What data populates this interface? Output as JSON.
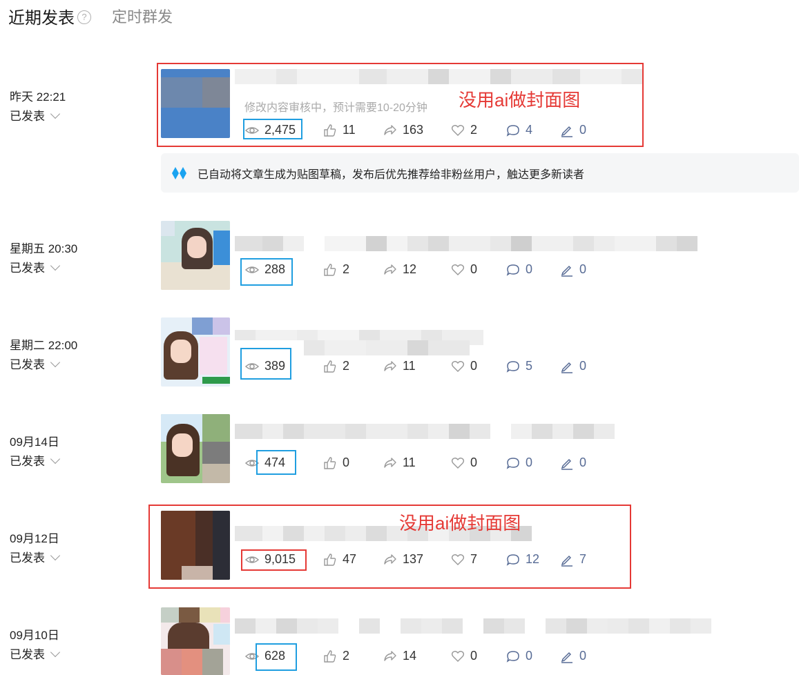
{
  "tabs": {
    "active": "近期发表",
    "other": "定时群发",
    "help_icon": "?"
  },
  "posts": [
    {
      "date": "昨天 22:21",
      "status": "已发表",
      "review_note": "修改内容审核中，预计需要10-20分钟",
      "stats": {
        "views": "2,475",
        "likes": "11",
        "shares": "163",
        "hearts": "2",
        "comments": "4",
        "edits": "0"
      },
      "annotation": "没用ai做封面图"
    },
    {
      "date": "星期五 20:30",
      "status": "已发表",
      "stats": {
        "views": "288",
        "likes": "2",
        "shares": "12",
        "hearts": "0",
        "comments": "0",
        "edits": "0"
      }
    },
    {
      "date": "星期二 22:00",
      "status": "已发表",
      "stats": {
        "views": "389",
        "likes": "2",
        "shares": "11",
        "hearts": "0",
        "comments": "5",
        "edits": "0"
      }
    },
    {
      "date": "09月14日",
      "status": "已发表",
      "stats": {
        "views": "474",
        "likes": "0",
        "shares": "11",
        "hearts": "0",
        "comments": "0",
        "edits": "0"
      }
    },
    {
      "date": "09月12日",
      "status": "已发表",
      "stats": {
        "views": "9,015",
        "likes": "47",
        "shares": "137",
        "hearts": "7",
        "comments": "12",
        "edits": "7"
      },
      "annotation": "没用ai做封面图"
    },
    {
      "date": "09月10日",
      "status": "已发表",
      "stats": {
        "views": "628",
        "likes": "2",
        "shares": "14",
        "hearts": "0",
        "comments": "0",
        "edits": "0"
      }
    }
  ],
  "notice": {
    "text": "已自动将文章生成为贴图草稿，发布后优先推荐给非粉丝用户，触达更多新读者",
    "icon": "diamond-icon"
  },
  "colors": {
    "annotation_red": "#e53935",
    "highlight_blue": "#1f9ee0",
    "link_blue": "#576b95",
    "notice_icon": "#1aa3f0"
  }
}
